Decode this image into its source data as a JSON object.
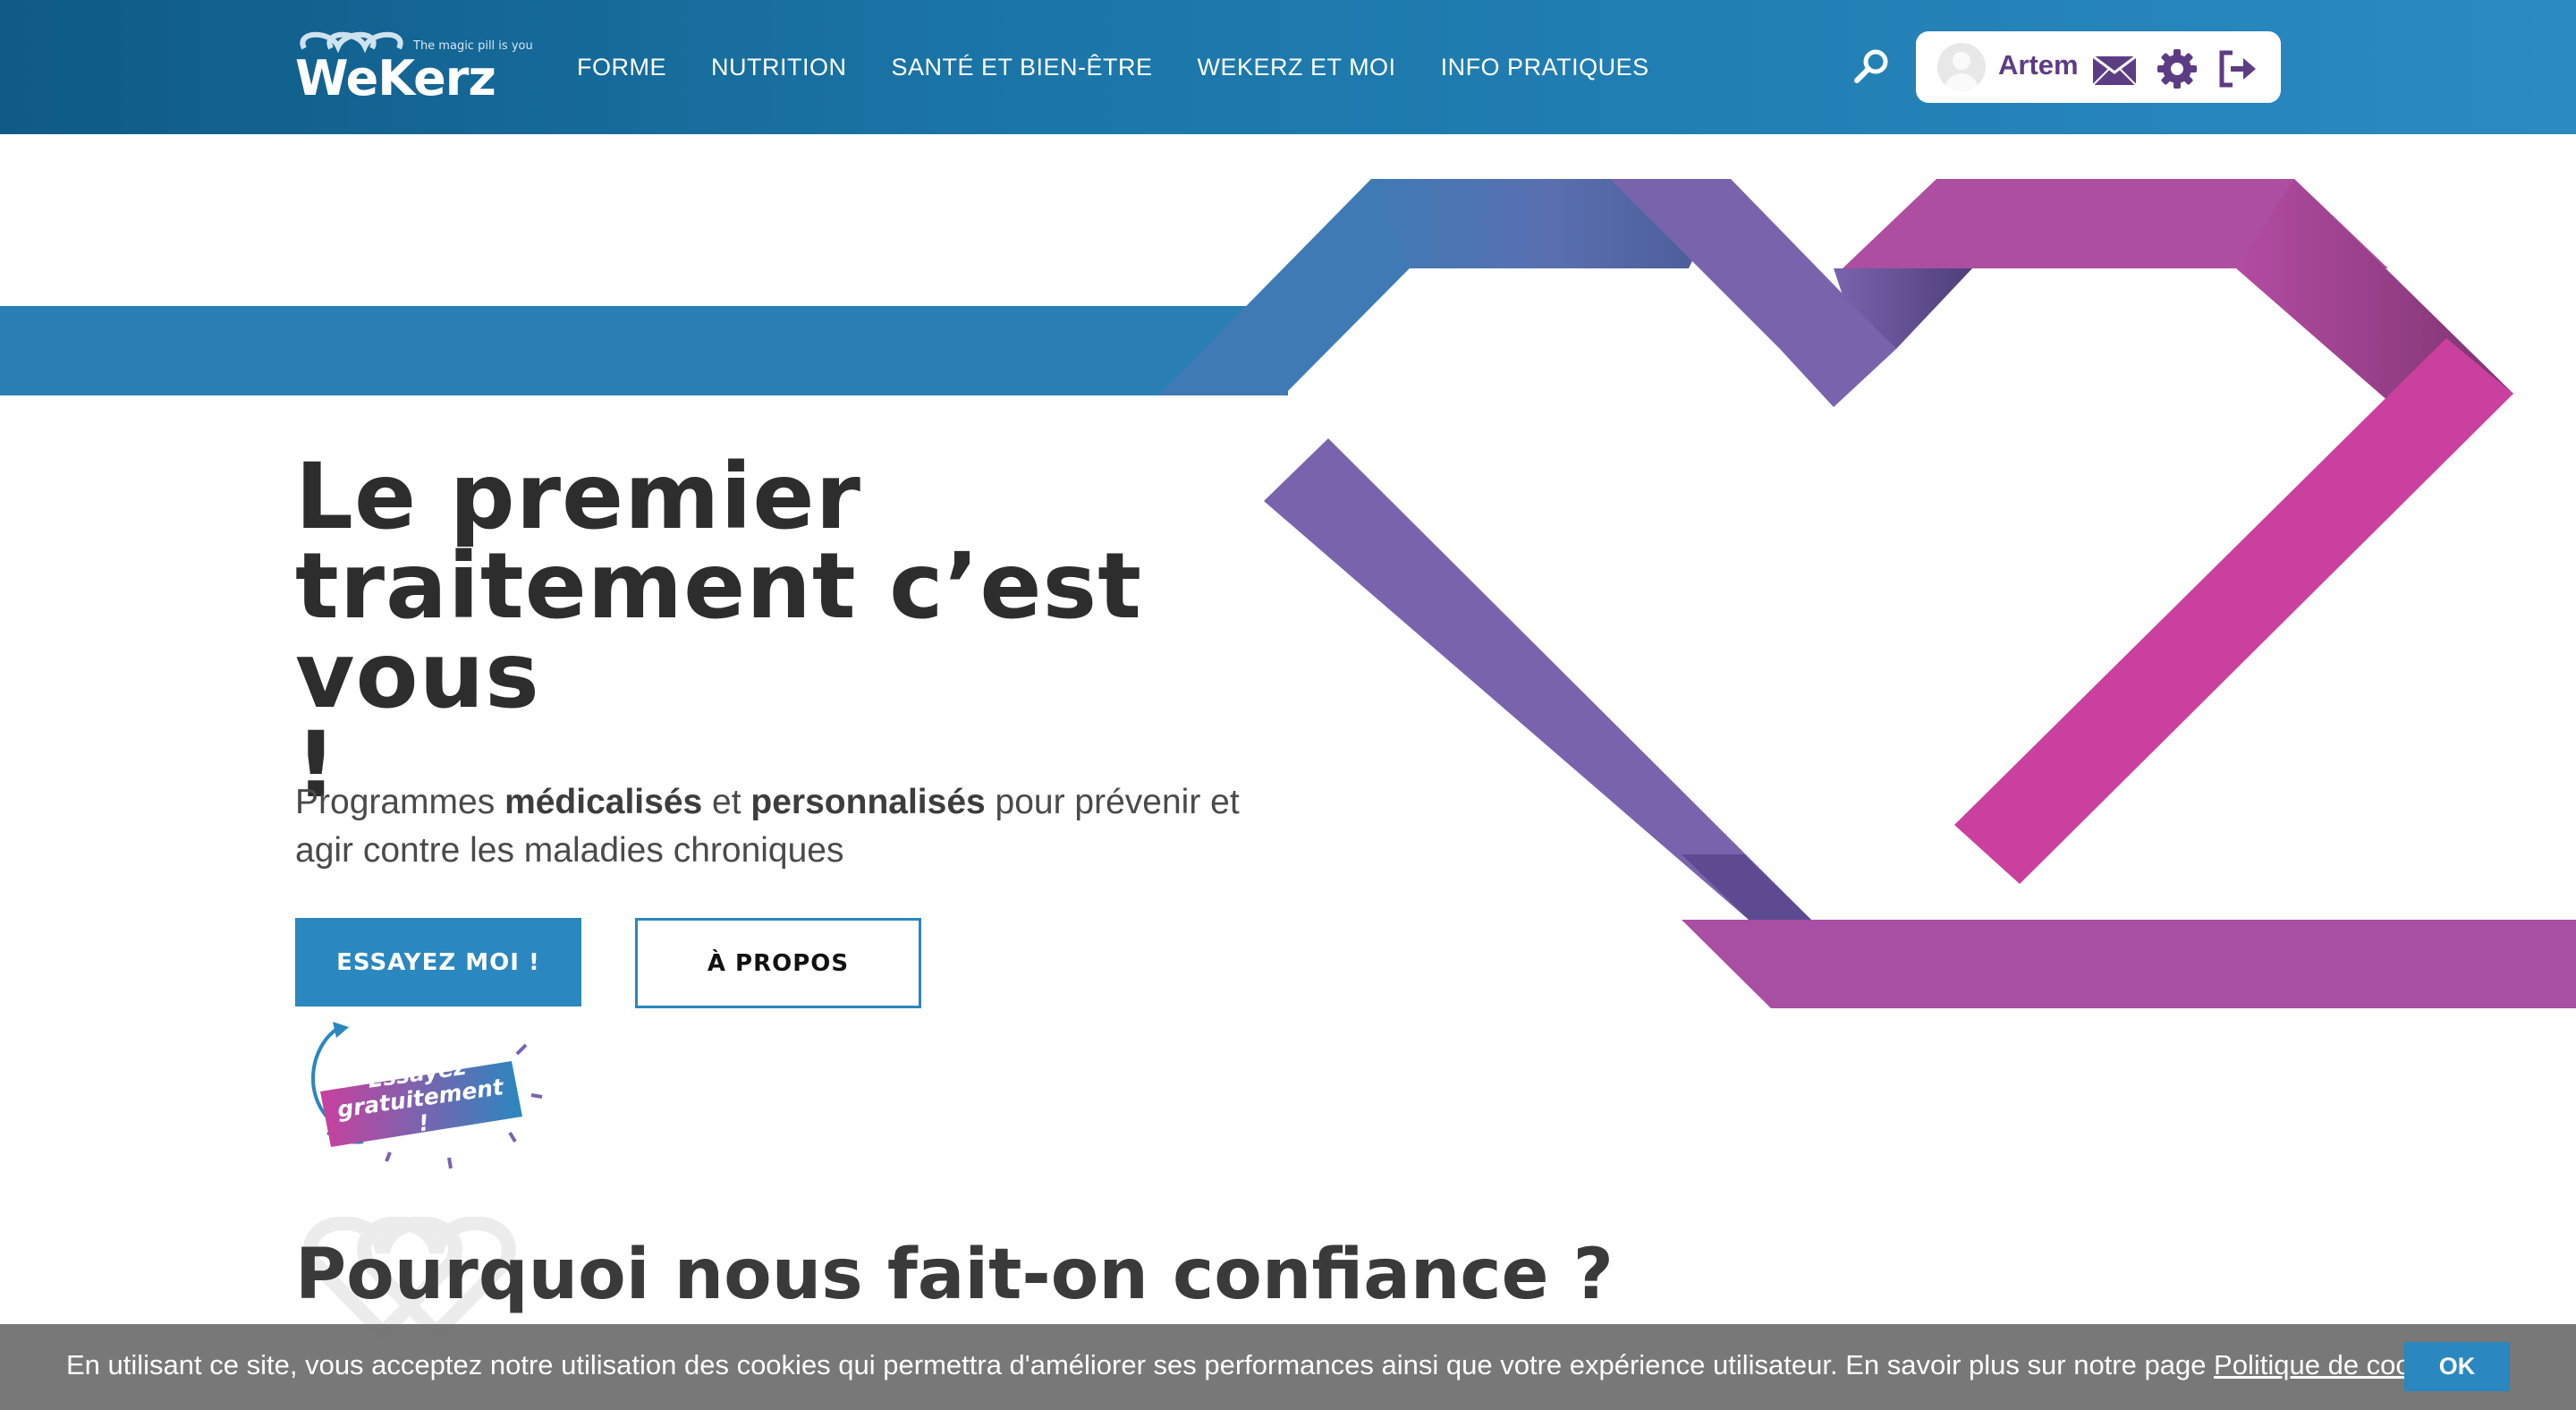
{
  "header": {
    "logo_tagline": "The magic pill is you",
    "logo_wordmark": "WeKerz",
    "nav": [
      "FORME",
      "NUTRITION",
      "SANTÉ ET BIEN-ÊTRE",
      "WEKERZ ET MOI",
      "INFO PRATIQUES"
    ],
    "user_name": "Artem",
    "icons": [
      "search-icon",
      "avatar-icon",
      "mail-icon",
      "gear-icon",
      "logout-icon"
    ]
  },
  "hero": {
    "title_line1": "Le premier",
    "title_line2": "traitement c’est vous",
    "title_line3": "!",
    "subtitle_part1": "Programmes ",
    "subtitle_bold1": "médicalisés",
    "subtitle_part2": " et ",
    "subtitle_bold2": "personnalisés",
    "subtitle_part3": " pour prévenir et agir contre les maladies chroniques",
    "btn_try": "ESSAYEZ MOI !",
    "btn_about": "À PROPOS",
    "badge_line1": "Essayez",
    "badge_line2": "gratuitement !"
  },
  "section": {
    "title": "Pourquoi nous fait-on confiance ?"
  },
  "cookie": {
    "text": "En utilisant ce site, vous acceptez notre utilisation des cookies qui permettra d'améliorer ses performances ainsi que votre expérience utilisateur. En savoir plus sur notre page ",
    "link": "Politique de cookies",
    "ok": "OK"
  },
  "colors": {
    "brand_blue": "#2a87bf",
    "ribbon_blue": "#3f7ab5",
    "ribbon_purple": "#7a63ad",
    "ribbon_magenta": "#c9409e",
    "user_purple": "#5c3d84"
  }
}
